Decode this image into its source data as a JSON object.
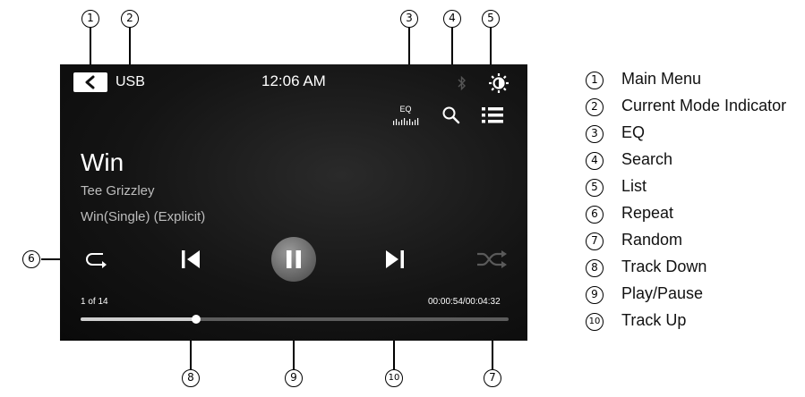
{
  "screen": {
    "mode": "USB",
    "time": "12:06 AM",
    "eq_label": "EQ",
    "track_title": "Win",
    "artist": "Tee Grizzley",
    "album": "Win(Single) (Explicit)",
    "track_count": "1 of 14",
    "elapsed_total": "00:00:54/00:04:32",
    "progress_fraction": 0.27
  },
  "callouts": [
    "1",
    "2",
    "3",
    "4",
    "5",
    "6",
    "7",
    "8",
    "9",
    "10"
  ],
  "legend": [
    {
      "num": "1",
      "label": "Main Menu"
    },
    {
      "num": "2",
      "label": "Current Mode Indicator"
    },
    {
      "num": "3",
      "label": "EQ"
    },
    {
      "num": "4",
      "label": "Search"
    },
    {
      "num": "5",
      "label": "List"
    },
    {
      "num": "6",
      "label": "Repeat"
    },
    {
      "num": "7",
      "label": "Random"
    },
    {
      "num": "8",
      "label": "Track Down"
    },
    {
      "num": "9",
      "label": "Play/Pause"
    },
    {
      "num": "10",
      "label": "Track Up"
    }
  ]
}
